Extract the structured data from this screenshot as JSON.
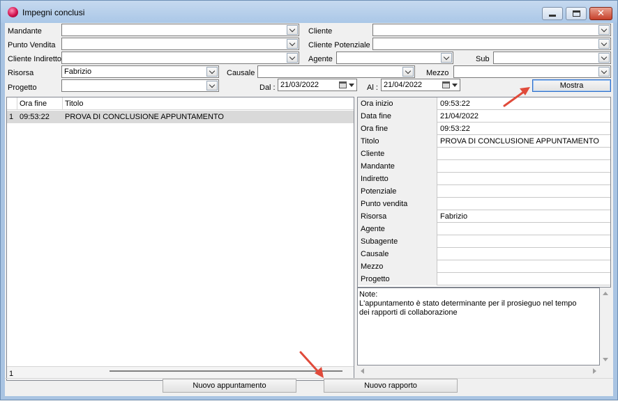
{
  "window": {
    "title": "Impegni conclusi",
    "app_icon": "app-logo-icon"
  },
  "filters": {
    "mandante_label": "Mandante",
    "cliente_label": "Cliente",
    "punto_vendita_label": "Punto Vendita",
    "cliente_potenziale_label": "Cliente Potenziale",
    "cliente_indiretto_label": "Cliente Indiretto",
    "agente_label": "Agente",
    "sub_label": "Sub",
    "risorsa_label": "Risorsa",
    "risorsa_value": "Fabrizio",
    "causale_label": "Causale",
    "mezzo_label": "Mezzo",
    "progetto_label": "Progetto",
    "dal_label": "Dal :",
    "dal_value": "21/03/2022",
    "al_label": "Al :",
    "al_value": "21/04/2022",
    "mostra_label": "Mostra"
  },
  "grid": {
    "columns": [
      "Ora fine",
      "Titolo"
    ],
    "rows": [
      {
        "index": "1",
        "ora_fine": "09:53:22",
        "titolo": "PROVA DI CONCLUSIONE APPUNTAMENTO"
      }
    ],
    "footer_count": "1"
  },
  "details": [
    {
      "key": "Ora inizio",
      "value": "09:53:22"
    },
    {
      "key": "Data fine",
      "value": "21/04/2022"
    },
    {
      "key": "Ora fine",
      "value": "09:53:22"
    },
    {
      "key": "Titolo",
      "value": "PROVA DI CONCLUSIONE APPUNTAMENTO"
    },
    {
      "key": "Cliente",
      "value": ""
    },
    {
      "key": "Mandante",
      "value": ""
    },
    {
      "key": "Indiretto",
      "value": ""
    },
    {
      "key": "Potenziale",
      "value": ""
    },
    {
      "key": "Punto vendita",
      "value": ""
    },
    {
      "key": "Risorsa",
      "value": "Fabrizio"
    },
    {
      "key": "Agente",
      "value": ""
    },
    {
      "key": "Subagente",
      "value": ""
    },
    {
      "key": "Causale",
      "value": ""
    },
    {
      "key": "Mezzo",
      "value": ""
    },
    {
      "key": "Progetto",
      "value": ""
    }
  ],
  "notes": {
    "line1": "Note:",
    "line2": "L'appuntamento è stato determinante per il prosieguo nel tempo",
    "line3": "dei rapporti di collaborazione"
  },
  "footer": {
    "nuovo_appuntamento_label": "Nuovo appuntamento",
    "nuovo_rapporto_label": "Nuovo rapporto"
  },
  "colors": {
    "annotation_arrow": "#e04a3a",
    "row_selected": "#d9d9d9",
    "title_bar": "#aac7e7"
  }
}
